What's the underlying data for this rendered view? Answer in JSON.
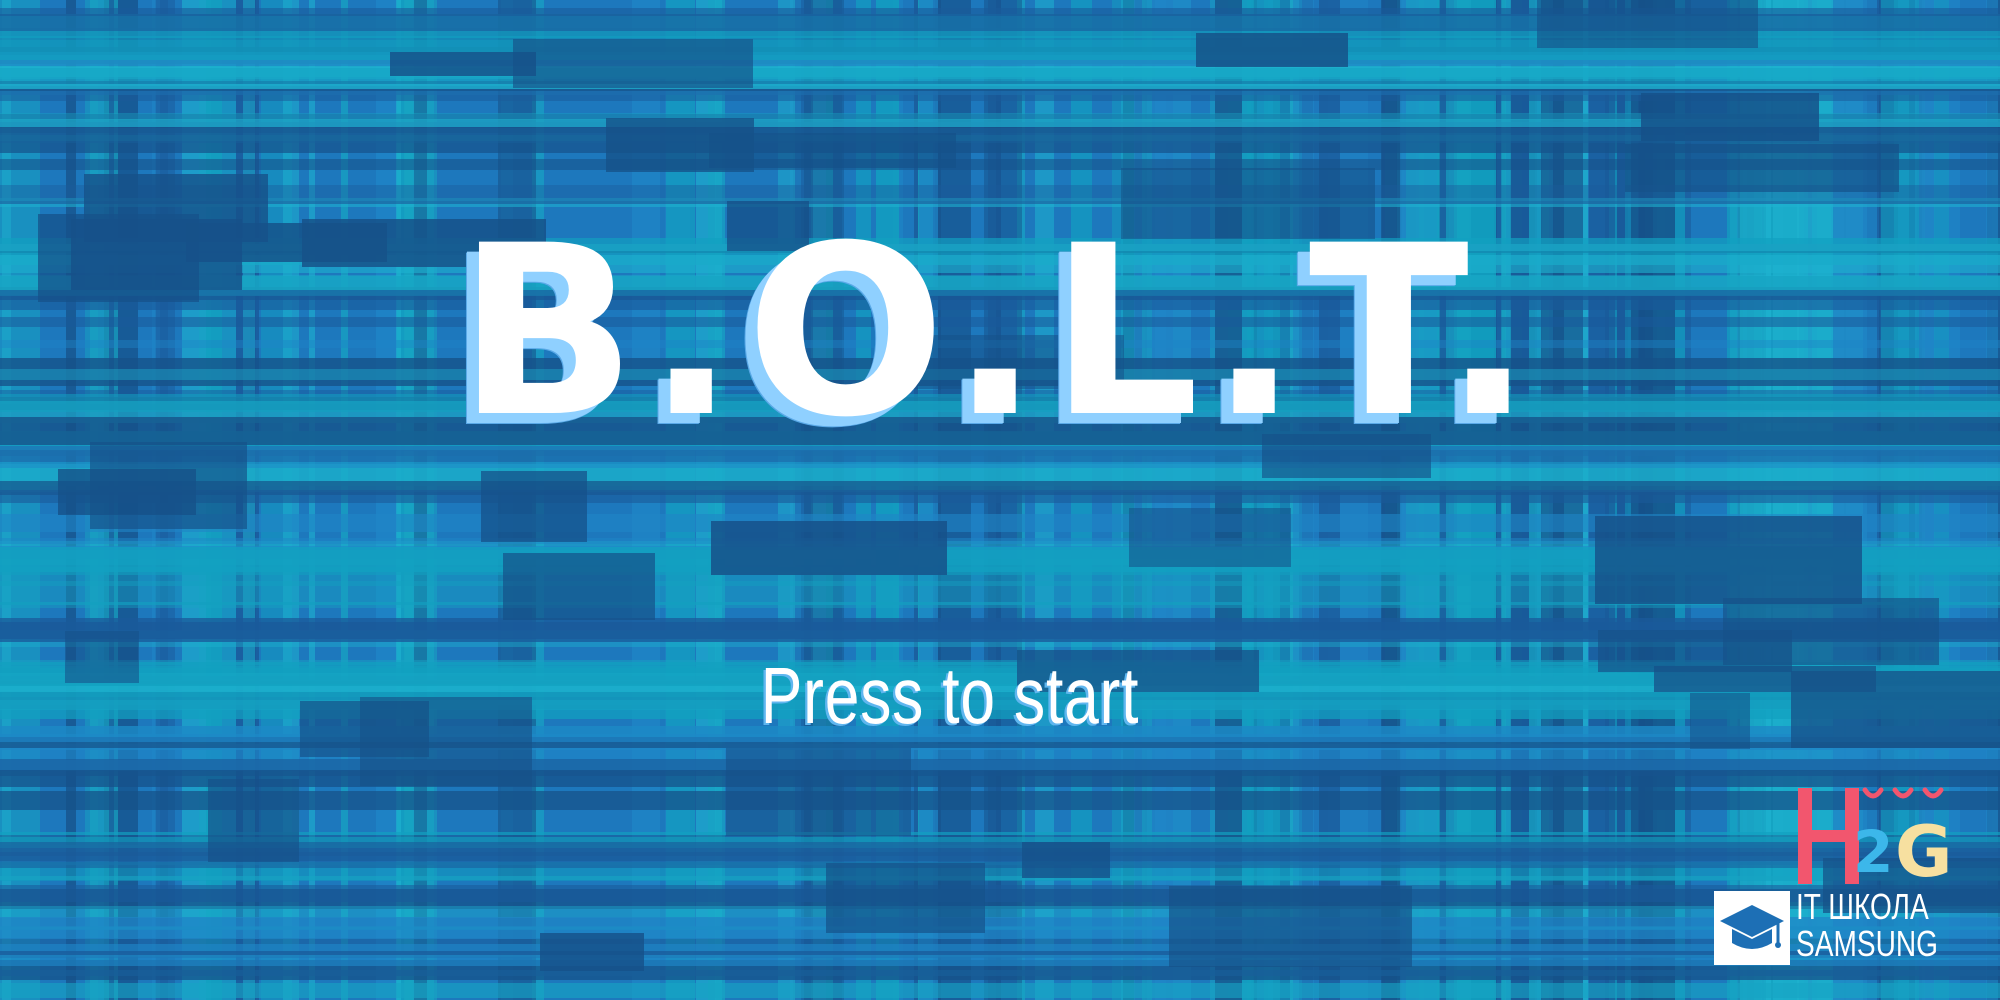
{
  "screen": {
    "title": "B.O.L.T.",
    "prompt": "Press to start"
  },
  "branding": {
    "h2g_letters": [
      "H",
      "2",
      "G"
    ],
    "school_line1": "IT ШКОЛА",
    "school_line2": "SAMSUNG",
    "icons": [
      "graduation-cap-icon"
    ]
  },
  "colors": {
    "background_blue": "#1d78bd",
    "dark_blue": "#1a5a9a",
    "teal": "#17a5c3",
    "cyan": "#1eb2cf",
    "title_white": "#ffffff",
    "title_shadow": "#8fd0ff",
    "h2g_red": "#f2566e",
    "h2g_blue": "#3cb7ea",
    "h2g_yellow": "#f7e0a0"
  }
}
